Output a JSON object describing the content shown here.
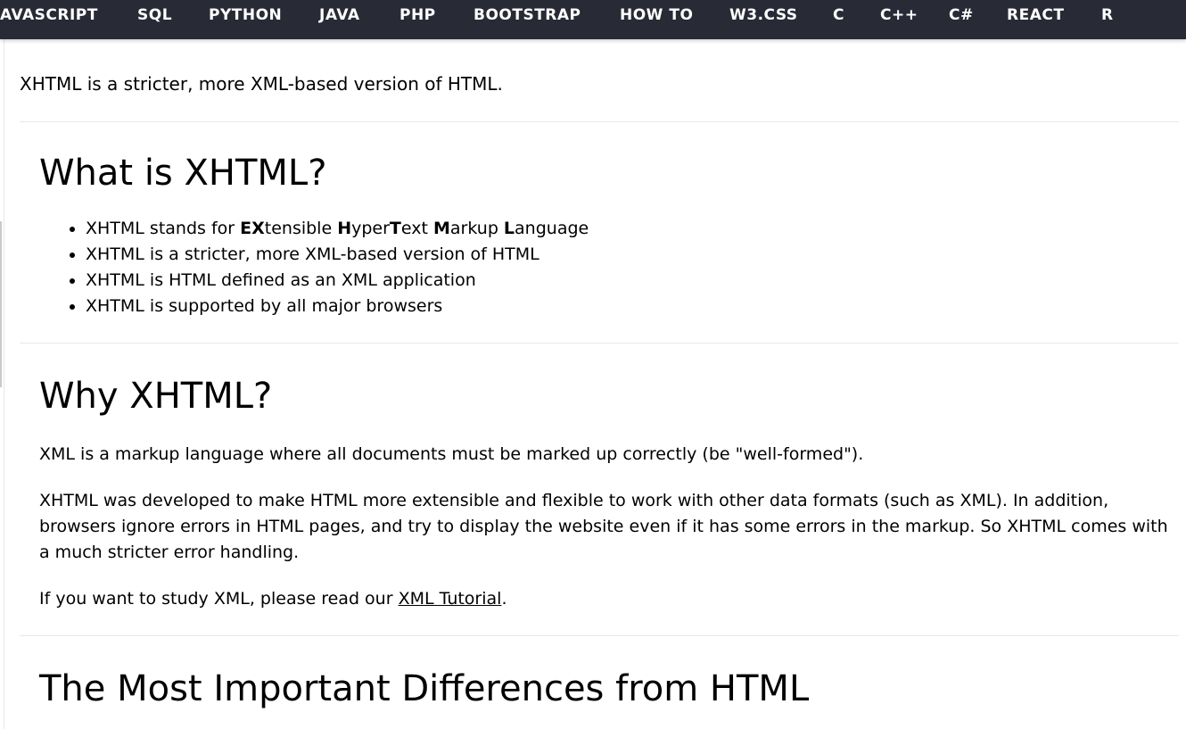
{
  "nav": {
    "items": [
      "AVASCRIPT",
      "SQL",
      "PYTHON",
      "JAVA",
      "PHP",
      "BOOTSTRAP",
      "HOW TO",
      "W3.CSS",
      "C",
      "C++",
      "C#",
      "REACT",
      "R"
    ]
  },
  "intro": {
    "text": "XHTML is a stricter, more XML-based version of HTML."
  },
  "section_what": {
    "heading": "What is XHTML?",
    "item1": {
      "p1": "XHTML stands for ",
      "b1": "EX",
      "p2": "tensible ",
      "b2": "H",
      "p3": "yper",
      "b3": "T",
      "p4": "ext ",
      "b4": "M",
      "p5": "arkup ",
      "b5": "L",
      "p6": "anguage"
    },
    "item2": "XHTML is a stricter, more XML-based version of HTML",
    "item3": "XHTML is HTML defined as an XML application",
    "item4": "XHTML is supported by all major browsers"
  },
  "section_why": {
    "heading": "Why XHTML?",
    "para1": "XML is a markup language where all documents must be marked up correctly (be \"well-formed\").",
    "para2": "XHTML was developed to make HTML more extensible and flexible to work with other data formats (such as XML). In addition, browsers ignore errors in HTML pages, and try to display the website even if it has some errors in the markup. So XHTML comes with a much stricter error handling.",
    "para3_prefix": "If you want to study XML, please read our ",
    "para3_link": "XML Tutorial",
    "para3_suffix": "."
  },
  "section_diff": {
    "heading": "The Most Important Differences from HTML"
  },
  "colors": {
    "nav_background": "#282a35",
    "nav_text": "#ffffff",
    "separator": "#e8e8e8"
  }
}
